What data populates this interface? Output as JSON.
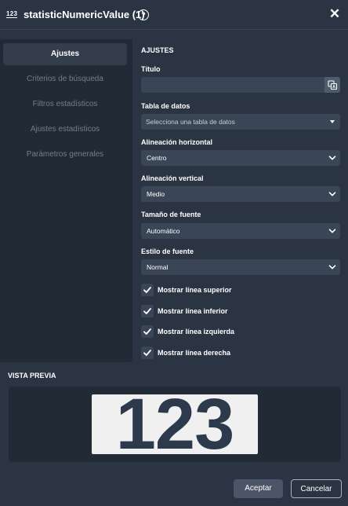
{
  "header": {
    "type_icon": "123",
    "title": "statisticNumericValue (1)",
    "help_icon": "?",
    "close_icon": "✕"
  },
  "sidebar": {
    "items": [
      {
        "label": "Ajustes",
        "active": true
      },
      {
        "label": "Criterios de búsqueda",
        "active": false
      },
      {
        "label": "Filtros estadísticos",
        "active": false
      },
      {
        "label": "Ajustes estadísticos",
        "active": false
      },
      {
        "label": "Parámetros generales",
        "active": false
      }
    ]
  },
  "settings": {
    "section_title": "AJUSTES",
    "title_label": "Título",
    "title_value": "",
    "data_table_label": "Tabla de datos",
    "data_table_placeholder": "Selecciona una tabla de datos",
    "h_align_label": "Alineación horizontal",
    "h_align_value": "Centro",
    "v_align_label": "Alineación vertical",
    "v_align_value": "Medio",
    "font_size_label": "Tamaño de fuente",
    "font_size_value": "Automático",
    "font_style_label": "Estilo de fuente",
    "font_style_value": "Normal",
    "checkboxes": [
      {
        "label": "Mostrar línea superior",
        "checked": true
      },
      {
        "label": "Mostrar línea inferior",
        "checked": true
      },
      {
        "label": "Mostrar línea izquierda",
        "checked": true
      },
      {
        "label": "Mostrar línea derecha",
        "checked": true
      }
    ]
  },
  "preview": {
    "title": "VISTA PREVIA",
    "value": "123"
  },
  "footer": {
    "accept_label": "Aceptar",
    "cancel_label": "Cancelar"
  },
  "colors": {
    "background": "#2b3442",
    "sidebar": "#222a36",
    "field": "#3a4556",
    "preview_text": "#2d3a4c"
  }
}
